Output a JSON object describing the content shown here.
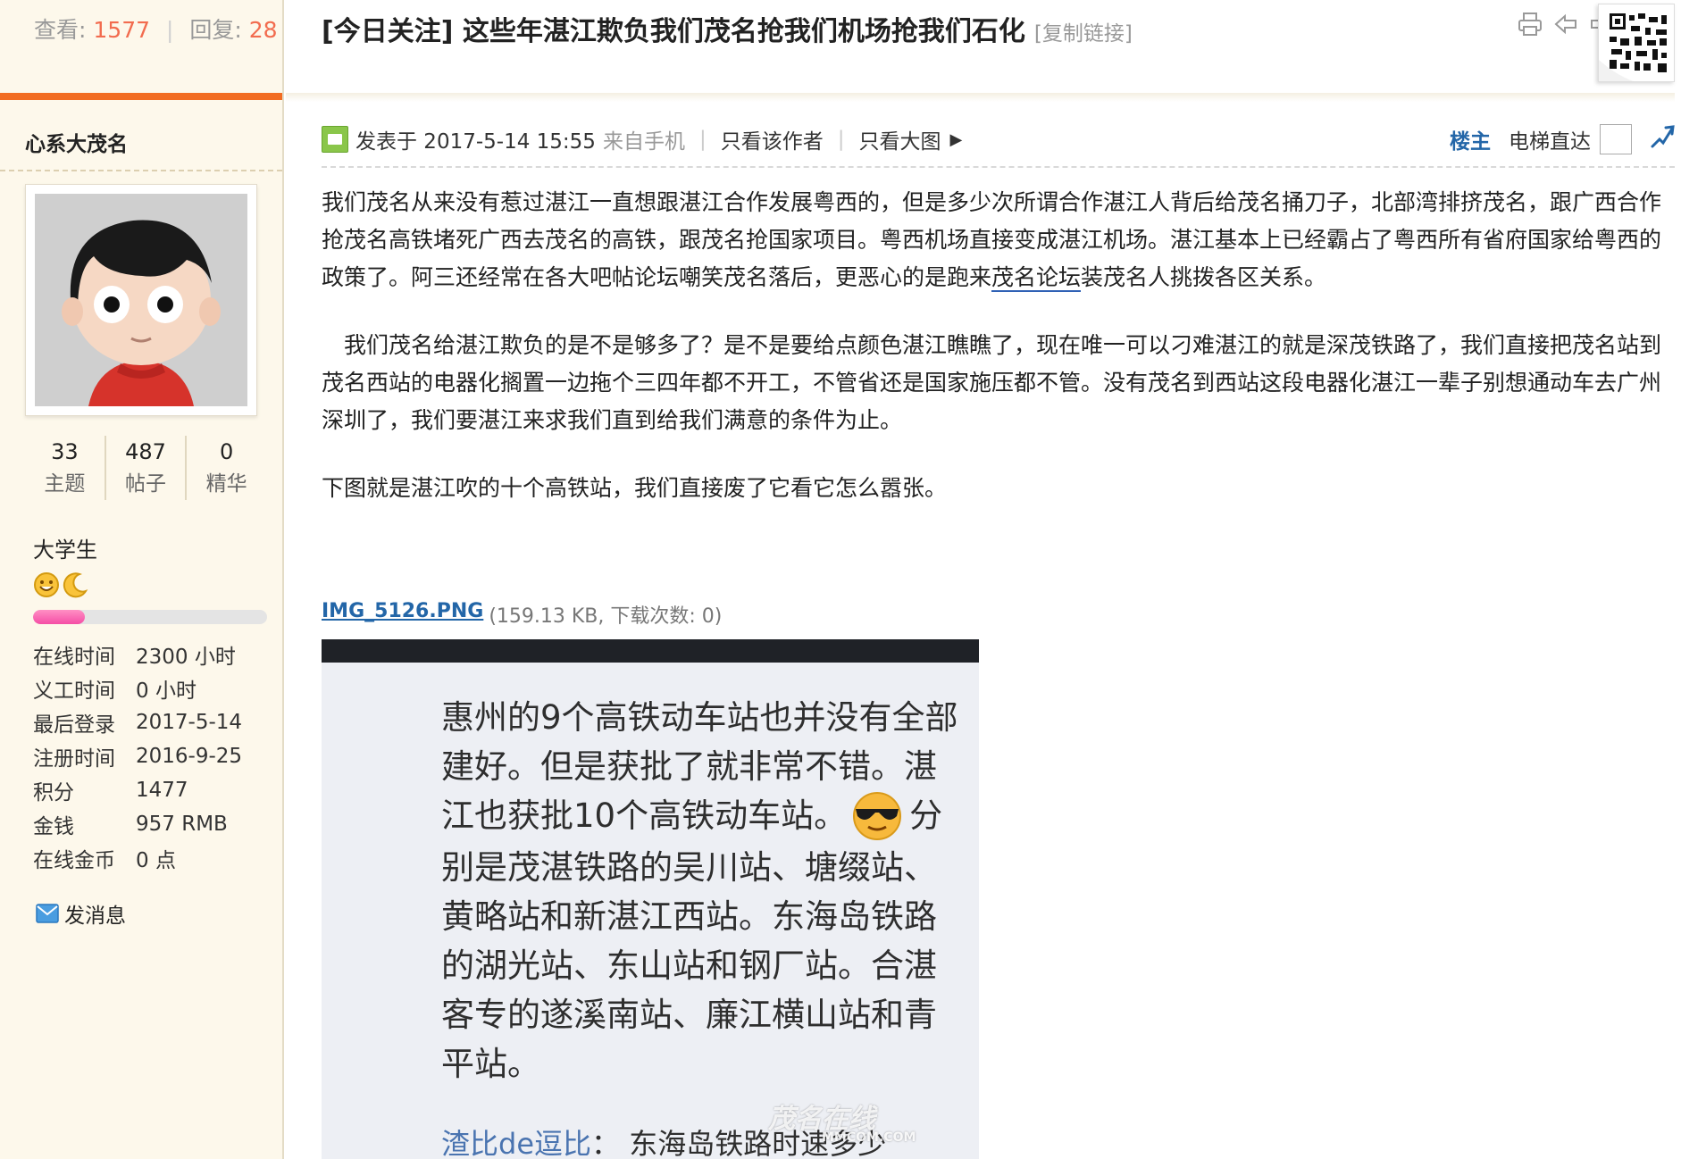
{
  "stats": {
    "views_label": "查看:",
    "views": "1577",
    "sep": "|",
    "replies_label": "回复:",
    "replies": "28"
  },
  "author": {
    "name": "心系大茂名",
    "counts": [
      {
        "num": "33",
        "label": "主题"
      },
      {
        "num": "487",
        "label": "帖子"
      },
      {
        "num": "0",
        "label": "精华"
      }
    ],
    "rank": "大学生",
    "level_progress": 0.22,
    "profile": [
      {
        "k": "在线时间",
        "v": "2300 小时"
      },
      {
        "k": "义工时间",
        "v": "0 小时"
      },
      {
        "k": "最后登录",
        "v": "2017-5-14"
      },
      {
        "k": "注册时间",
        "v": "2016-9-25"
      },
      {
        "k": "积分",
        "v": "1477"
      },
      {
        "k": "金钱",
        "v": "957 RMB"
      },
      {
        "k": "在线金币",
        "v": "0 点"
      }
    ],
    "send_message": "发消息"
  },
  "thread": {
    "title": "[今日关注] 这些年湛江欺负我们茂名抢我们机场抢我们石化",
    "copy_link": "[复制链接]"
  },
  "meta": {
    "posted": "发表于 2017-5-14 15:55",
    "from": "来自手机",
    "sep": "|",
    "only_author": "只看该作者",
    "only_images": "只看大图",
    "floor": "楼主",
    "elevator": "电梯直达"
  },
  "post": {
    "p1_before": "我们茂名从来没有惹过湛江一直想跟湛江合作发展粤西的，但是多少次所谓合作湛江人背后给茂名捅刀子，北部湾排挤茂名，跟广西合作抢茂名高铁堵死广西去茂名的高铁，跟茂名抢国家项目。粤西机场直接变成湛江机场。湛江基本上已经霸占了粤西所有省府国家给粤西的政策了。阿三还经常在各大吧帖论坛嘲笑茂名落后，更恶心的是跑来",
    "p1_link": "茂名论坛",
    "p1_after": "装茂名人挑拨各区关系。",
    "p2": "　我们茂名给湛江欺负的是不是够多了？是不是要给点颜色湛江瞧瞧了，现在唯一可以刁难湛江的就是深茂铁路了，我们直接把茂名站到茂名西站的电器化搁置一边拖个三四年都不开工，不管省还是国家施压都不管。没有茂名到西站这段电器化湛江一辈子别想通动车去广州深圳了，我们要湛江来求我们直到给我们满意的条件为止。",
    "p3": "下图就是湛江吹的十个高铁站，我们直接废了它看它怎么嚣张。"
  },
  "attachment": {
    "name": "IMG_5126.PNG",
    "info": "(159.13 KB, 下载次数: 0)"
  },
  "image": {
    "text_before": "惠州的9个高铁动车站也并没有全部建好。但是获批了就非常不错。湛江也获批10个高铁动车站。",
    "text_after": "分别是茂湛铁路的吴川站、塘缀站、黄略站和新湛江西站。东海岛铁路的湖光站、东山站和钢厂站。合湛客专的遂溪南站、廉江横山站和青平站。",
    "reply_name": "渣比de逗比",
    "reply_text": "：  东海岛铁路时速多少",
    "watermark": "茂名在线",
    "watermark_sub": "MMCOM.COM"
  },
  "colors": {
    "accent_orange": "#f26c22",
    "link_blue": "#2366a8",
    "sidebar_bg": "#fdf8eb"
  },
  "icons": [
    "print-icon",
    "prev-thread-icon",
    "next-thread-icon",
    "qr-code-icon",
    "mobile-post-icon",
    "arrow-right-icon",
    "jump-icon",
    "mail-icon",
    "smile-rank-icon",
    "moon-rank-icon",
    "sunglasses-emoji-icon"
  ]
}
